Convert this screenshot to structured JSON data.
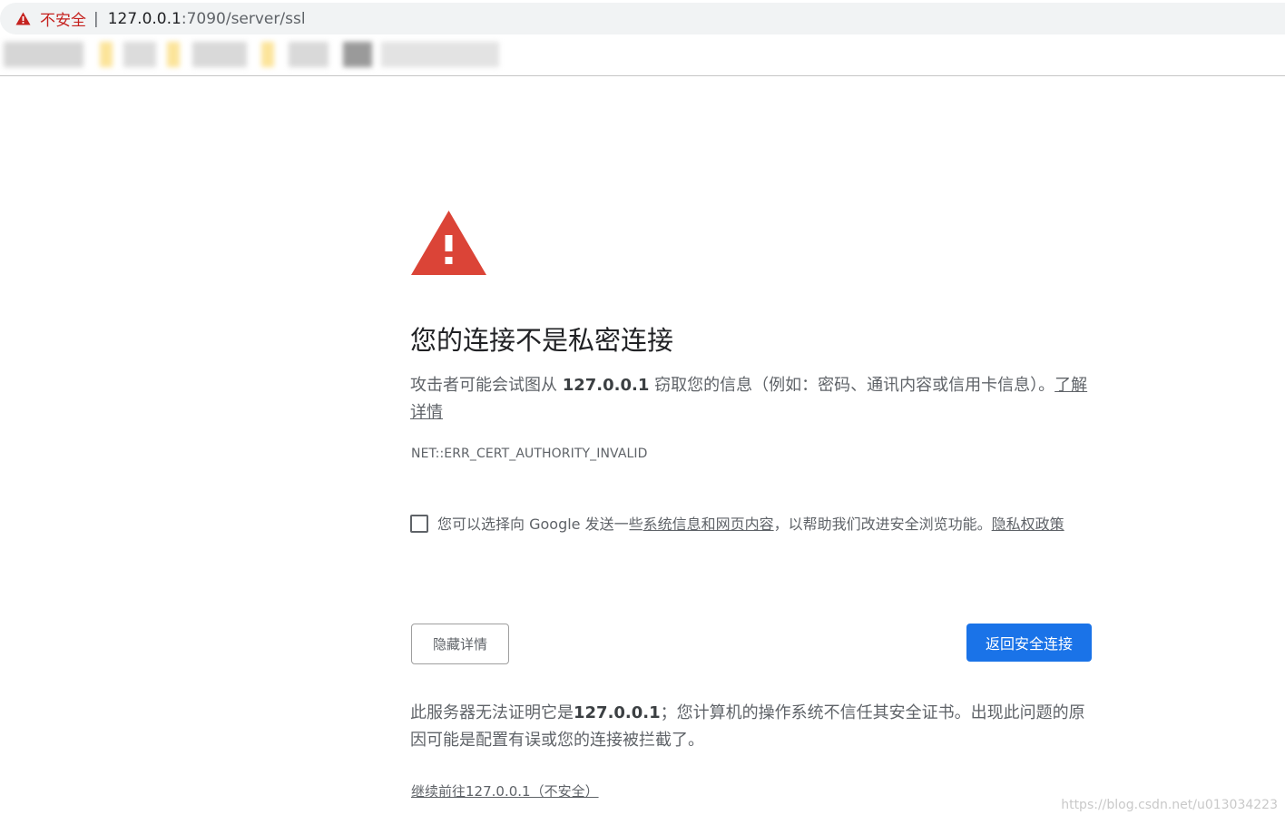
{
  "address_bar": {
    "security_label": "不安全",
    "separator": "|",
    "url_host": "127.0.0.1",
    "url_rest": ":7090/server/ssl",
    "warn_icon": "warning-triangle-icon",
    "warn_color": "#c5221f"
  },
  "interstitial": {
    "icon": "warning-triangle-icon",
    "icon_color": "#db4437",
    "heading": "您的连接不是私密连接",
    "message_pre": "攻击者可能会试图从 ",
    "message_host": "127.0.0.1",
    "message_post": " 窃取您的信息（例如：密码、通讯内容或信用卡信息）。",
    "learn_more": "了解详情",
    "error_code": "NET::ERR_CERT_AUTHORITY_INVALID",
    "optin": {
      "text_pre": "您可以选择向 Google 发送一些",
      "link_system_info": "系统信息和网页内容",
      "text_mid": "，以帮助我们改进安全浏览功能。",
      "link_privacy": "隐私权政策",
      "checked": false
    },
    "buttons": {
      "details": "隐藏详情",
      "back_to_safety": "返回安全连接"
    },
    "details": {
      "pre": "此服务器无法证明它是",
      "host": "127.0.0.1",
      "post": "；您计算机的操作系统不信任其安全证书。出现此问题的原因可能是配置有误或您的连接被拦截了。"
    },
    "proceed_link": "继续前往127.0.0.1（不安全）"
  },
  "watermark": "https://blog.csdn.net/u013034223",
  "colors": {
    "primary_button": "#1a73e8",
    "text_secondary": "#5f6368"
  }
}
